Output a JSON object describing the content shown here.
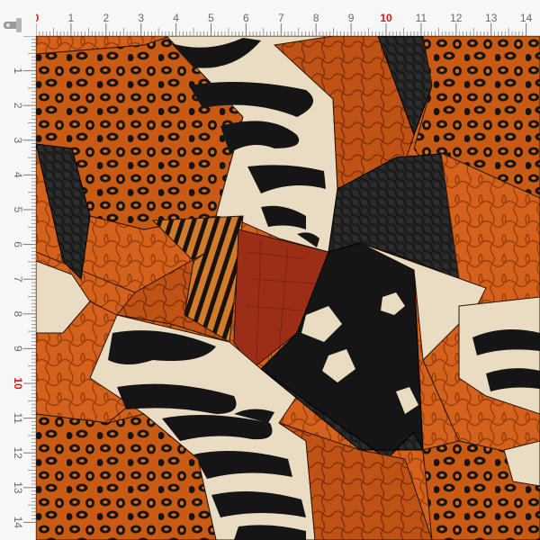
{
  "ruler": {
    "top_labels": [
      "0",
      "1",
      "2",
      "3",
      "4",
      "5",
      "6",
      "7",
      "8",
      "9",
      "10",
      "11",
      "12",
      "13",
      "14"
    ],
    "left_labels": [
      "1",
      "2",
      "3",
      "4",
      "5",
      "6",
      "7",
      "8",
      "9",
      "10",
      "11",
      "12",
      "13",
      "14"
    ],
    "accent_color": "#d31a1a",
    "tick_color": "#7a7a7a"
  },
  "fabric": {
    "pattern": "animal-print patchwork",
    "palette": {
      "orange": "#d4621c",
      "burnt_orange": "#a8400c",
      "black": "#151515",
      "cream": "#eadcc2",
      "rust_red": "#9c2e18",
      "tan": "#c8793a"
    }
  }
}
